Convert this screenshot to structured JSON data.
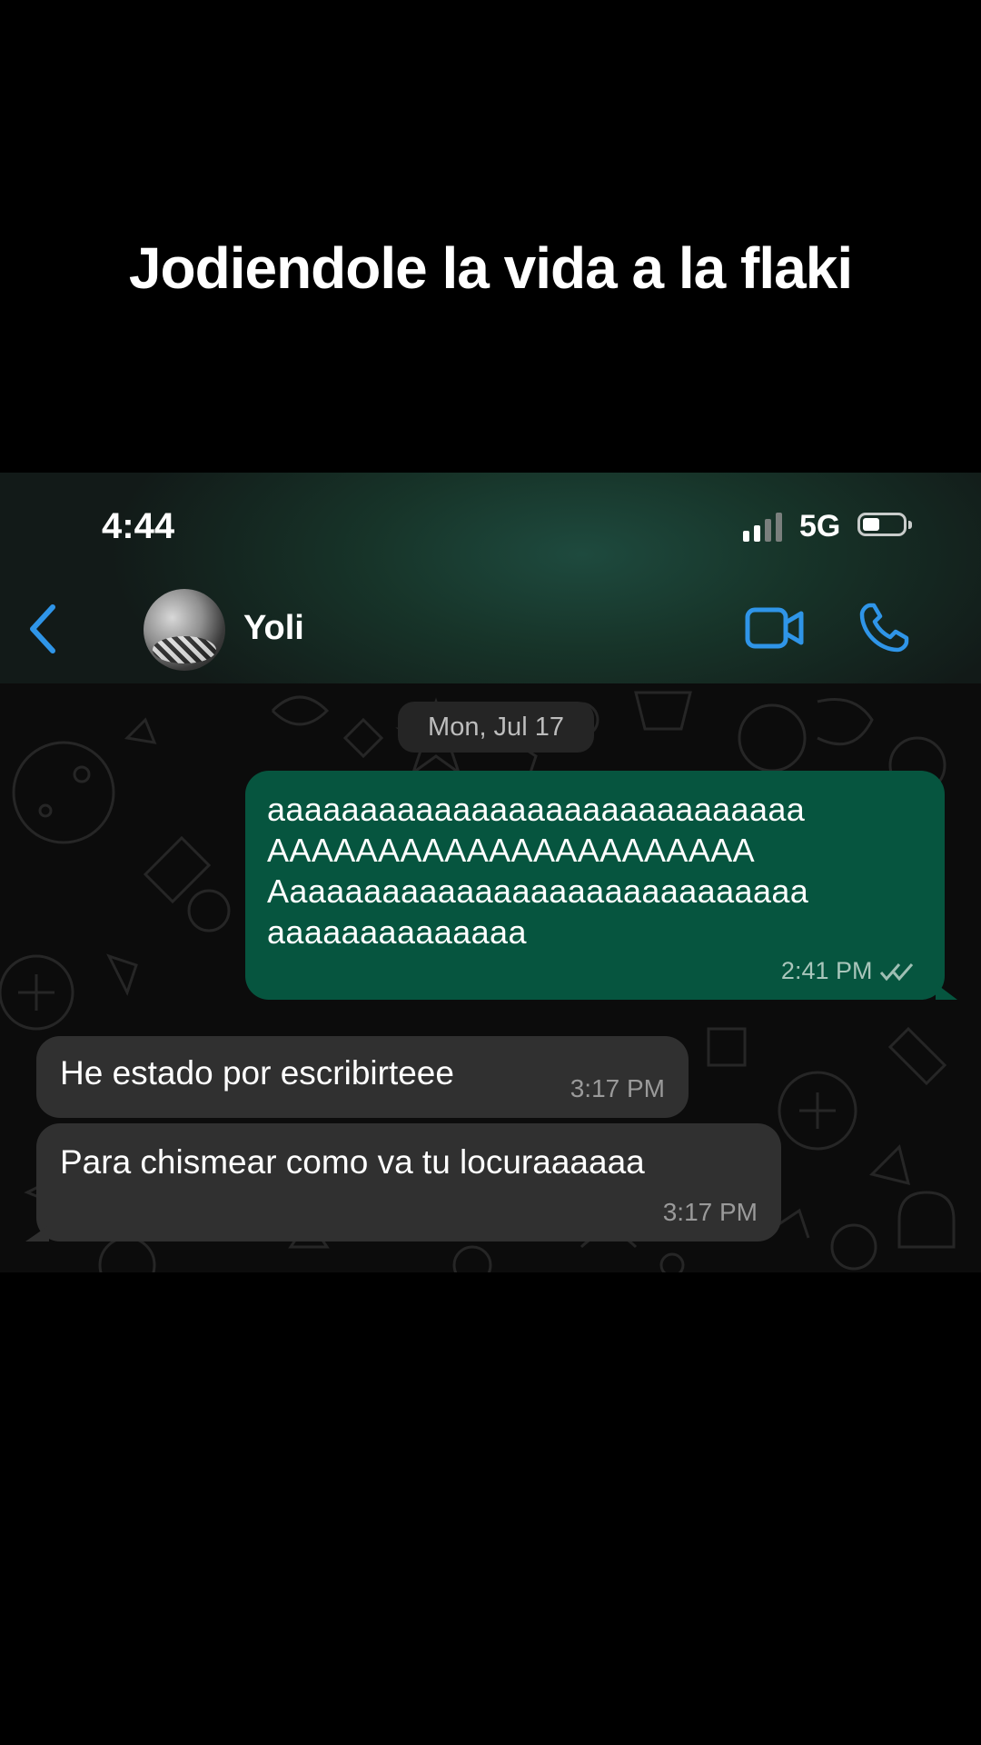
{
  "caption": "Jodiendole la vida a la flaki",
  "status_bar": {
    "time": "4:44",
    "network": "5G"
  },
  "header": {
    "contact_name": "Yoli"
  },
  "chat": {
    "date_label": "Mon, Jul 17",
    "messages": [
      {
        "direction": "outgoing",
        "lines": [
          "aaaaaaaaaaaaaaaaaaaaaaaaaaaaa",
          "AAAAAAAAAAAAAAAAAAAAAA",
          "Aaaaaaaaaaaaaaaaaaaaaaaaaaaaa",
          "aaaaaaaaaaaaaa"
        ],
        "time": "2:41 PM"
      },
      {
        "direction": "incoming",
        "text": "He estado por escribirteee",
        "time": "3:17 PM"
      },
      {
        "direction": "incoming",
        "text": "Para chismear como va tu locuraaaaaa",
        "time": "3:17 PM"
      }
    ]
  },
  "colors": {
    "outgoing_bubble": "#06553f",
    "incoming_bubble": "#303030",
    "accent_blue": "#2f95e8"
  }
}
